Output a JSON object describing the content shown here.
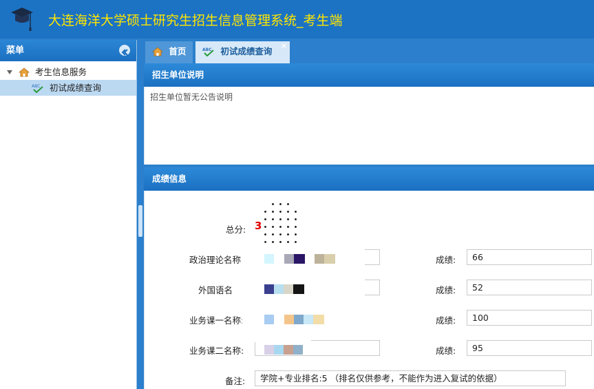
{
  "app": {
    "title": "大连海洋大学硕士研究生招生信息管理系统_考生端"
  },
  "sidebar": {
    "header": "菜单",
    "tree": {
      "root_label": "考生信息服务",
      "child_label": "初试成绩查询"
    }
  },
  "tabs": [
    {
      "label": "首页"
    },
    {
      "label": "初试成绩查询",
      "close": "×"
    }
  ],
  "notice": {
    "title": "招生单位说明",
    "text": "招生单位暂无公告说明"
  },
  "scores": {
    "title": "成绩信息",
    "total_label": "总分:",
    "total_value": "3",
    "score_label": "成绩:",
    "rows": [
      {
        "name_label": "政治理论名称",
        "score": "66"
      },
      {
        "name_label": "外国语名",
        "score": "52"
      },
      {
        "name_label": "业务课一名称:",
        "score": "100"
      },
      {
        "name_label": "业务课二名称:",
        "score": "95"
      }
    ],
    "remark_label": "备注:",
    "remark_value": "学院+专业排名:5 （排名仅供参考，不能作为进入复试的依据）"
  },
  "colors": {
    "header_blue": "#1c73c4",
    "title_yellow": "#ffe600",
    "total_red": "#e00000"
  },
  "icons": [
    "graduation-cap-icon",
    "collapse-left-icon",
    "home-icon",
    "abc-check-icon",
    "close-icon",
    "expand-arrow-icon"
  ]
}
